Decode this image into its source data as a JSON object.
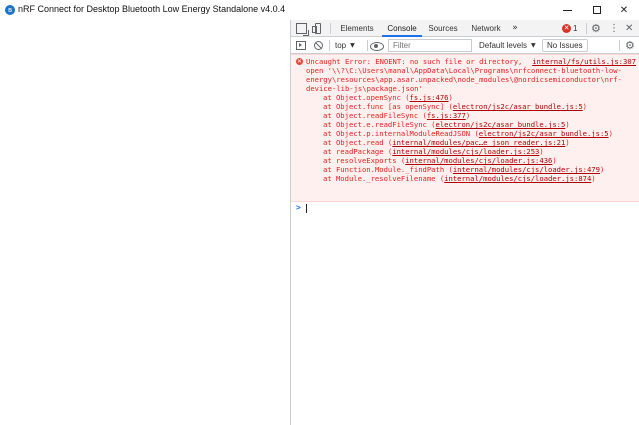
{
  "window": {
    "title": "nRF Connect for Desktop Bluetooth Low Energy Standalone v4.0.4",
    "icon": "bluetooth-icon",
    "icon_glyph": "ʙ",
    "minimize": "minimize-icon",
    "maximize": "maximize-icon",
    "close": "✕"
  },
  "devtools": {
    "tabs": [
      "Elements",
      "Console",
      "Sources",
      "Network"
    ],
    "more_tabs": "»",
    "active_tab": "Console",
    "error_count": "1",
    "error_glyph": "✕",
    "settings_glyph": "⚙",
    "more_glyph": "⋮",
    "close_glyph": "✕"
  },
  "console_toolbar": {
    "context": "top",
    "caret": "▼",
    "filter_placeholder": "Filter",
    "levels": "Default levels",
    "issues": "No Issues",
    "settings_glyph": "⚙"
  },
  "error": {
    "line1": "Uncaught Error: ENOENT: no such file or directory, ",
    "source": "internal/fs/utils.js:307",
    "line2": "open '\\\\?\\C:\\Users\\manal\\AppData\\Local\\Programs\\nrfconnect-bluetooth-low-",
    "line3": "energy\\resources\\app.asar.unpacked\\node_modules\\@nordicsemiconductor\\nrf-",
    "line4": "device-lib-js\\package.json'",
    "stack": [
      {
        "fn": "at Object.openSync (",
        "loc": "fs.js:476",
        "end": ")"
      },
      {
        "fn": "at Object.func [as openSync] (",
        "loc": "electron/js2c/asar_bundle.js:5",
        "end": ")"
      },
      {
        "fn": "at Object.readFileSync (",
        "loc": "fs.js:377",
        "end": ")"
      },
      {
        "fn": "at Object.e.readFileSync (",
        "loc": "electron/js2c/asar_bundle.js:5",
        "end": ")"
      },
      {
        "fn": "at Object.p.internalModuleReadJSON (",
        "loc": "electron/js2c/asar_bundle.js:5",
        "end": ")"
      },
      {
        "fn": "at Object.read (",
        "loc": "internal/modules/pac…e_json_reader.js:21",
        "end": ")"
      },
      {
        "fn": "at readPackage (",
        "loc": "internal/modules/cjs/loader.js:253",
        "end": ")"
      },
      {
        "fn": "at resolveExports (",
        "loc": "internal/modules/cjs/loader.js:436",
        "end": ")"
      },
      {
        "fn": "at Function.Module._findPath (",
        "loc": "internal/modules/cjs/loader.js:479",
        "end": ")"
      },
      {
        "fn": "at Module._resolveFilename (",
        "loc": "internal/modules/cjs/loader.js:874",
        "end": ")"
      }
    ]
  },
  "prompt": ">"
}
